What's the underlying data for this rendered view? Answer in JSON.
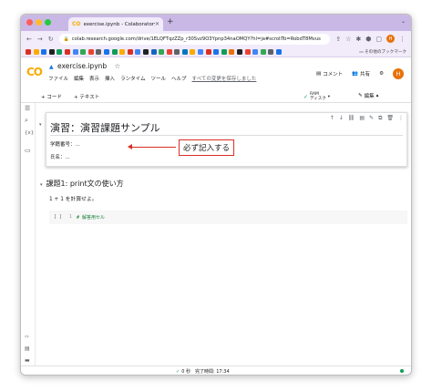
{
  "browser": {
    "tab_title": "exercise.ipynb - Colaboratory",
    "tab_favicon": "CO",
    "new_tab": "+",
    "url": "colab.research.google.com/drive/1ELQFTqzZZp_r30Svz9O3Ypnp34naOMQY?hl=ja#scrollTo=RobdT8Mvus",
    "bookmarks_folder": "その他のブックマーク",
    "profile_initial": "H"
  },
  "colab": {
    "logo": "CO",
    "filename": "exercise.ipynb",
    "star": "☆",
    "menus": [
      "ファイル",
      "編集",
      "表示",
      "挿入",
      "ランタイム",
      "ツール",
      "ヘルプ"
    ],
    "saved_note": "すべての変更を保存しました",
    "comment_label": "コメント",
    "share_label": "共有",
    "avatar_initial": "H"
  },
  "toolbar": {
    "add_code": "+ コード",
    "add_text": "+ テキスト",
    "ram": "RAM",
    "disk": "ディスク",
    "edit": "編集"
  },
  "cell1": {
    "title": "演習：演習課題サンプル",
    "line1": "学籍番号：...",
    "line2": "氏名：...",
    "callout": "必ず記入する"
  },
  "section": {
    "heading": "課題1: print文の使い方",
    "body": "1 + 1 を計算せよ。"
  },
  "code_cell": {
    "brackets": "[ ]",
    "line_number": "1",
    "code": "# 解答用セル"
  },
  "status": {
    "check": "✓",
    "text": "0 秒　完了時間: 17:34"
  }
}
